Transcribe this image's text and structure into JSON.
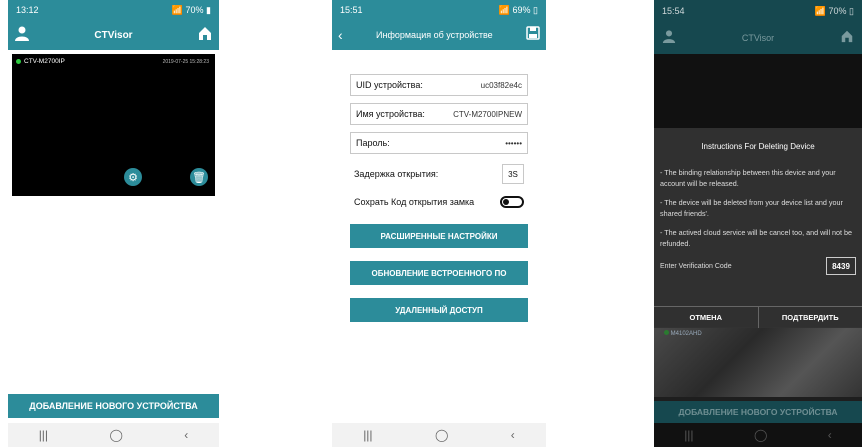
{
  "phone1": {
    "status_time": "13:12",
    "status_battery": "70%",
    "app_title": "CTVisor",
    "camera_name": "CTV-M2700IP",
    "camera_timestamp": "2019-07-25 15:28:23",
    "add_device_button": "ДОБАВЛЕНИЕ НОВОГО УСТРОЙСТВА"
  },
  "phone2": {
    "status_time": "15:51",
    "status_battery": "69%",
    "title": "Информация об устройстве",
    "fields": [
      {
        "label": "UID устройства:",
        "value": "uc03f82e4c"
      },
      {
        "label": "Имя устройства:",
        "value": "CTV-M2700IPNEW"
      },
      {
        "label": "Пароль:",
        "value": "••••••"
      }
    ],
    "delay_label": "Задержка открытия:",
    "delay_value": "3S",
    "save_code_label": "Сохрать Код открытия замка",
    "buttons": [
      "РАСШИРЕННЫЕ НАСТРОЙКИ",
      "ОБНОВЛЕНИЕ ВСТРОЕННОГО ПО",
      "УДАЛЕННЫЙ ДОСТУП"
    ]
  },
  "phone3": {
    "status_time": "15:54",
    "status_battery": "70%",
    "app_title": "CTVisor",
    "dialog": {
      "title": "Instructions For Deleting Device",
      "lines": [
        "- The binding relationship between this device and your account will be released.",
        "- The device will be deleted from your device list and your shared friends'.",
        "- The actived cloud service will be cancel too, and will not be refunded."
      ],
      "code_label": "Enter Verification Code",
      "code_value": "8439",
      "cancel": "ОТМЕНА",
      "confirm": "ПОДТВЕРДИТЬ"
    },
    "bg_camera_name": "M4102AHD",
    "add_device_button": "ДОБАВЛЕНИЕ НОВОГО УСТРОЙСТВА"
  },
  "nav": {
    "recent": "|||",
    "home": "◯",
    "back": "‹"
  },
  "colors": {
    "accent": "#2c8c9a"
  }
}
